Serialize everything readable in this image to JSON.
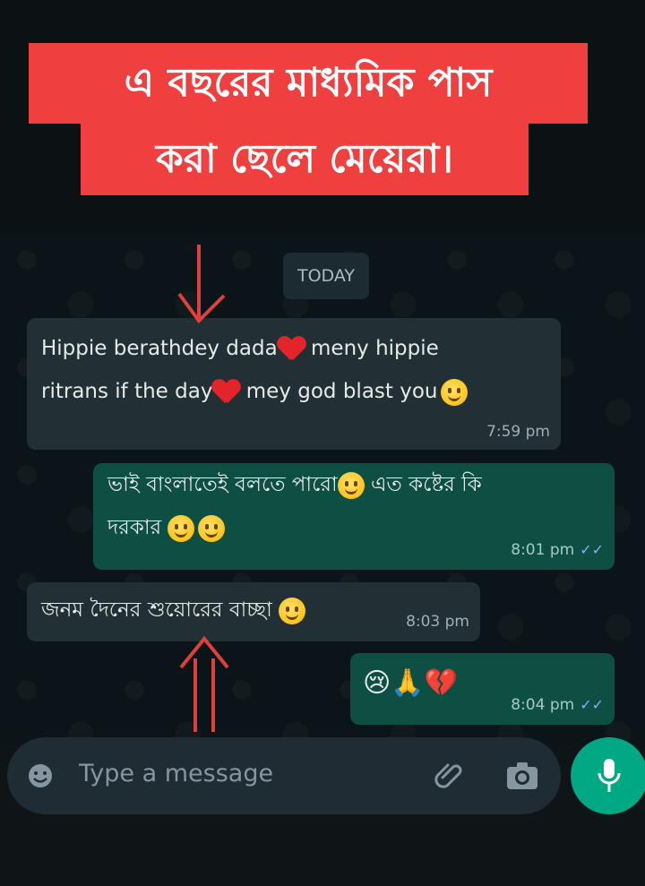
{
  "caption": {
    "line1": "এ বছরের মাধ্যমিক পাস",
    "line2": "করা ছেলে মেয়েরা।"
  },
  "chat": {
    "date_chip": "TODAY",
    "messages": [
      {
        "direction": "incoming",
        "line1_a": "Hippie berathdey dada",
        "line1_b": " meny hippie",
        "line2_a": "ritrans if the day",
        "line2_b": " mey god blast you",
        "time": "7:59 pm"
      },
      {
        "direction": "outgoing",
        "line1_a": "ভাই বাংলাতেই বলতে পারো",
        "line1_b": " এত কষ্টের কি",
        "line2_a": "দরকার ",
        "time": "8:01 pm",
        "status": "read"
      },
      {
        "direction": "incoming",
        "line1_a": "জনম দৈনের শুয়োরের বাচ্ছা ",
        "time": "8:03 pm"
      },
      {
        "direction": "outgoing",
        "emoji": "😢🙏💔",
        "time": "8:04 pm",
        "status": "read"
      }
    ]
  },
  "composer": {
    "placeholder": "Type a message",
    "icons": [
      "emoji-icon",
      "attach-icon",
      "camera-icon",
      "mic-icon"
    ]
  },
  "colors": {
    "caption_bg": "#ef3f3f",
    "incoming_bubble": "#222f35",
    "outgoing_bubble": "#0e4f44",
    "mic_button": "#00a884",
    "read_ticks": "#7fb2ff"
  }
}
